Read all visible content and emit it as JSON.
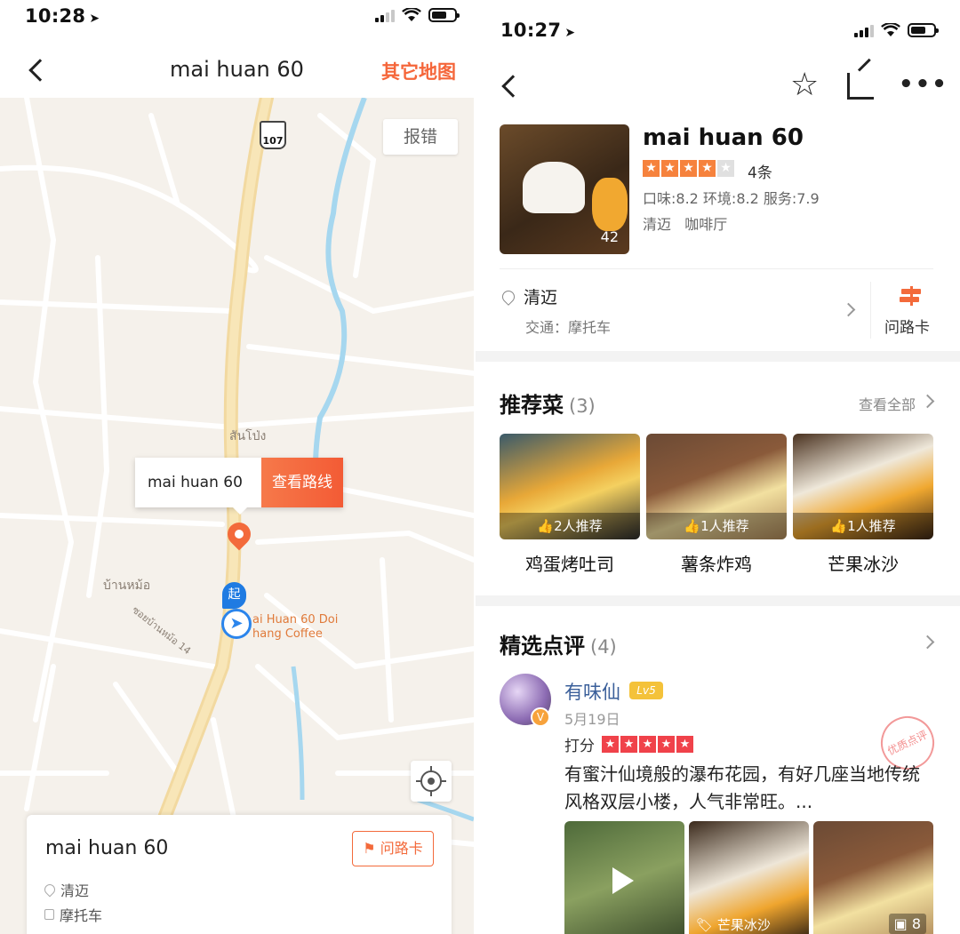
{
  "left": {
    "status": {
      "time": "10:28"
    },
    "nav": {
      "title": "mai huan 60",
      "other_maps": "其它地图"
    },
    "map": {
      "report_button": "报错",
      "route_shield": "107",
      "place_label_1": "สันโป่ง",
      "place_label_2": "บ้านหม้อ",
      "road_label": "ซอยบ้านหม้อ 14",
      "poi_label_line1": "ai Huan 60 Doi",
      "poi_label_line2": "hang Coffee",
      "popup_name": "mai huan 60",
      "popup_route_button": "查看路线",
      "start_marker": "起"
    },
    "card": {
      "name": "mai huan 60",
      "ask_way_button": "问路卡",
      "location": "清迈",
      "transport": "摩托车"
    }
  },
  "right": {
    "status": {
      "time": "10:27"
    },
    "shop": {
      "photo_count": "42",
      "name": "mai huan 60",
      "stars": 4,
      "review_count": "4条",
      "scores": "口味:8.2 环境:8.2 服务:7.9",
      "tags": "清迈   咖啡厅"
    },
    "address": {
      "city": "清迈",
      "traffic": "交通：摩托车",
      "ask_way": "问路卡"
    },
    "recommend": {
      "title": "推荐菜",
      "count": "(3)",
      "see_all": "查看全部",
      "dishes": [
        {
          "name": "鸡蛋烤吐司",
          "rec": "2人推荐"
        },
        {
          "name": "薯条炸鸡",
          "rec": "1人推荐"
        },
        {
          "name": "芒果冰沙",
          "rec": "1人推荐"
        }
      ]
    },
    "reviews": {
      "title": "精选点评",
      "count": "(4)",
      "user": "有味仙",
      "level": "Lv5",
      "date": "5月19日",
      "rating_label": "打分",
      "rating": 5,
      "text": "有蜜汁仙境般的瀑布花园，有好几座当地传统风格双层小楼，人气非常旺。...",
      "stamp": "优质点评",
      "photo_tag": "芒果冰沙",
      "photo_count": "8"
    }
  }
}
